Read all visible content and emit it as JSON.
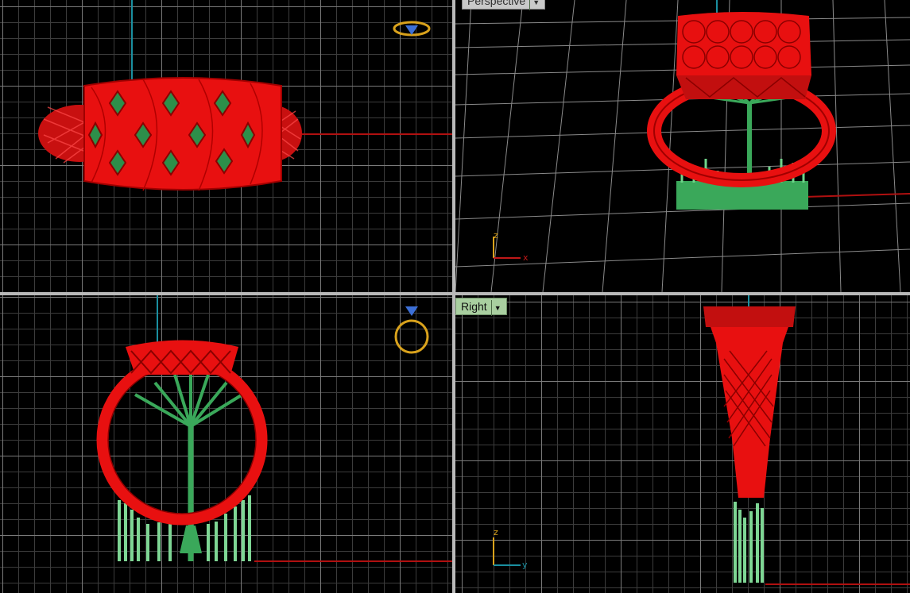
{
  "app": "3D modeling viewport layout",
  "viewports": {
    "top": {
      "name": ""
    },
    "perspective": {
      "name": "Perspective"
    },
    "front": {
      "name": ""
    },
    "right": {
      "name": "Right"
    }
  },
  "axes": {
    "perspective": {
      "x": "x",
      "z": "z"
    },
    "right": {
      "y": "y",
      "z": "z"
    }
  },
  "colors": {
    "model": "#e81010",
    "supports": "#4fbf6a",
    "x_axis": "#b01010",
    "z_axis": "#1a8fa0",
    "widget": "#d9a21c",
    "gem": "#3c6fd6",
    "grid_major": "#7a7a7a",
    "grid_minor": "#3c3c3c",
    "label_bg": "#a9cfa0"
  },
  "icons": {
    "view_cube_top": "ring-widget-icon",
    "view_cube_front": "ring-widget-icon"
  }
}
